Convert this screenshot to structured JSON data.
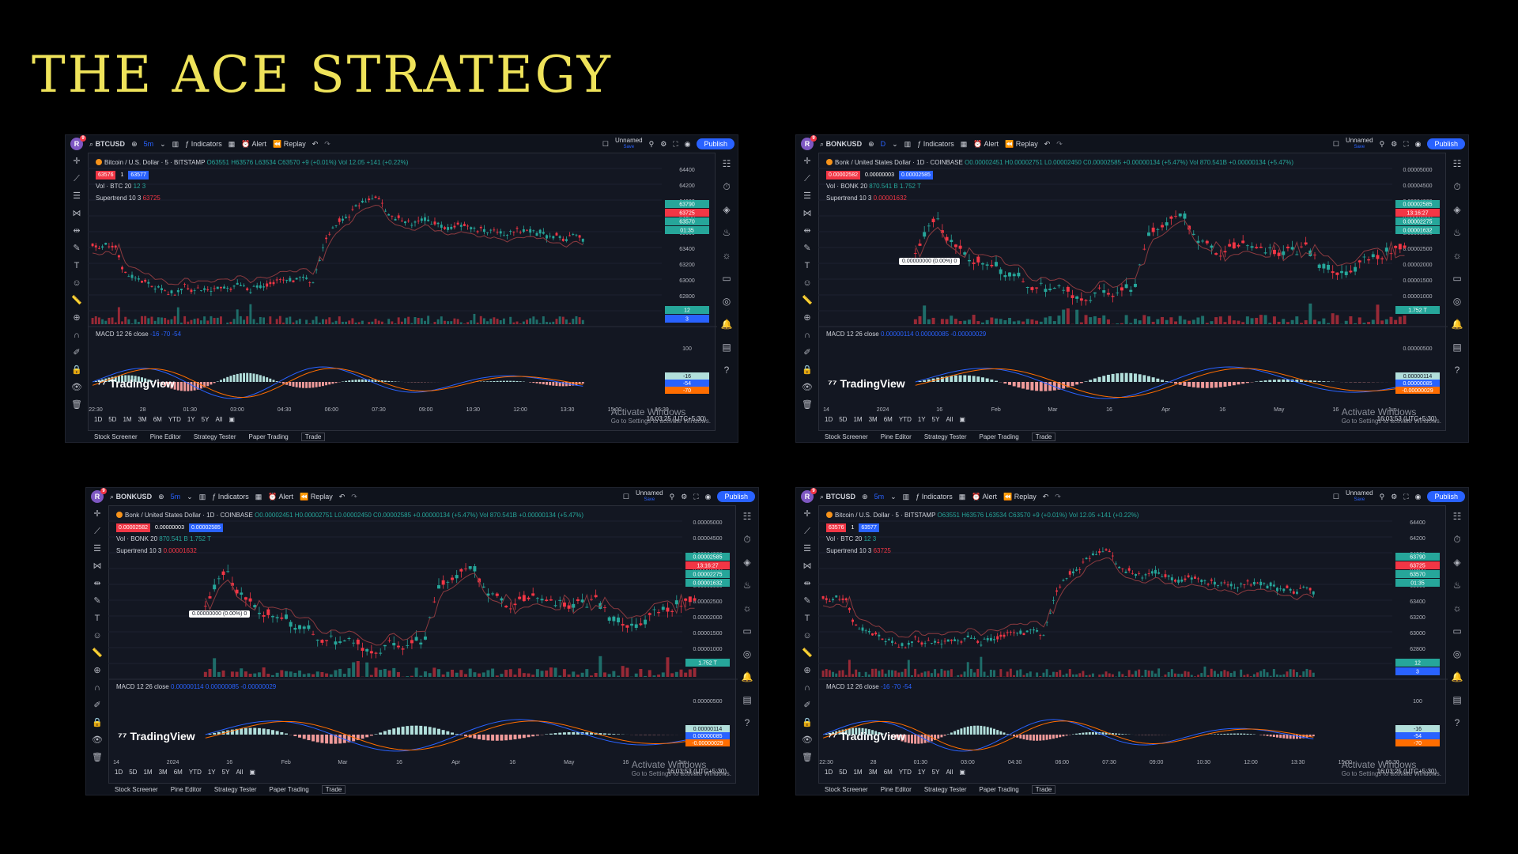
{
  "slide_title": "THE ACE STRATEGY",
  "colors": {
    "accent": "#efe35a",
    "up": "#26a69a",
    "down": "#f23645",
    "blue": "#2962ff",
    "bg": "#131722"
  },
  "panels": [
    {
      "symbol": "BTCUSD",
      "interval": "5m",
      "title": "Bitcoin / U.S. Dollar · 5 · BITSTAMP",
      "ohlc": "O63551 H63576 L63534 C63570 +9 (+0.01%)",
      "vol_reading": "Vol 12.05 +141 (+0.22%)",
      "sell": "63576",
      "qty": "1",
      "buy": "63577",
      "vol_label": "Vol · BTC 20",
      "vol_vals": "12  3",
      "st_label": "Supertrend 10 3",
      "st_val": "63725",
      "macd_label": "MACD 12 26 close",
      "macd_vals": "-16  -70  -54",
      "price_ticks": [
        "64400",
        "64200",
        "64000",
        "63800",
        "63600",
        "63400",
        "63200",
        "63000",
        "62800",
        "62600"
      ],
      "price_tags": [
        "63790",
        "63725",
        "63570",
        "01:35",
        "12",
        "3"
      ],
      "macd_ticks": [
        "100"
      ],
      "macd_tags": [
        "-16",
        "-54",
        "-70"
      ],
      "time_ticks": [
        "22:30",
        "28",
        "01:30",
        "03:00",
        "04:30",
        "06:00",
        "07:30",
        "09:00",
        "10:30",
        "12:00",
        "13:30",
        "15:00",
        "16:30"
      ],
      "tip": "",
      "clock": "16:03:25 (UTC+5:30)",
      "series": {
        "type": "btc",
        "seed": 11
      }
    },
    {
      "symbol": "BONKUSD",
      "interval": "D",
      "title": "Bonk / United States Dollar · 1D · COINBASE",
      "ohlc": "O0.00002451 H0.00002751 L0.00002450 C0.00002585 +0.00000134 (+5.47%)",
      "vol_reading": "Vol 870.541B +0.00000134 (+5.47%)",
      "sell": "0.00002582",
      "qty": "0.00000003",
      "buy": "0.00002585",
      "vol_label": "Vol · BONK 20",
      "vol_vals": "870.541 B  1.752 T",
      "st_label": "Supertrend 10 3",
      "st_val": "0.00001632",
      "macd_label": "MACD 12 26 close",
      "macd_vals": "0.00000114  0.00000085  -0.00000029",
      "price_ticks": [
        "0.00005000",
        "0.00004500",
        "0.00004000",
        "0.00003500",
        "0.00003000",
        "0.00002500",
        "0.00002000",
        "0.00001500",
        "0.00001000",
        "0.00000500"
      ],
      "price_tags": [
        "0.00002585",
        "13:16:27",
        "0.00002275",
        "0.00001632",
        "1.752 T"
      ],
      "macd_ticks": [
        "0.00000500"
      ],
      "macd_tags": [
        "0.00000114",
        "0.00000085",
        "-0.00000029"
      ],
      "time_ticks": [
        "14",
        "2024",
        "16",
        "Feb",
        "Mar",
        "16",
        "Apr",
        "16",
        "May",
        "16",
        "Jun"
      ],
      "tip": "0.00000000 (0.00%) 0",
      "clock": "16:03:53 (UTC+5:30)",
      "series": {
        "type": "bonk",
        "seed": 23
      }
    },
    {
      "symbol": "BONKUSD",
      "interval": "5m",
      "title": "Bonk / United States Dollar · 1D · COINBASE",
      "ohlc": "O0.00002451 H0.00002751 L0.00002450 C0.00002585 +0.00000134 (+5.47%)",
      "vol_reading": "Vol 870.541B +0.00000134 (+5.47%)",
      "sell": "0.00002582",
      "qty": "0.00000003",
      "buy": "0.00002585",
      "vol_label": "Vol · BONK 20",
      "vol_vals": "870.541 B  1.752 T",
      "st_label": "Supertrend 10 3",
      "st_val": "0.00001632",
      "macd_label": "MACD 12 26 close",
      "macd_vals": "0.00000114  0.00000085  -0.00000029",
      "price_ticks": [
        "0.00005000",
        "0.00004500",
        "0.00004000",
        "0.00003500",
        "0.00003000",
        "0.00002500",
        "0.00002000",
        "0.00001500",
        "0.00001000",
        "0.00000500"
      ],
      "price_tags": [
        "0.00002585",
        "13:16:27",
        "0.00002275",
        "0.00001632",
        "1.752 T"
      ],
      "macd_ticks": [
        "0.00000500"
      ],
      "macd_tags": [
        "0.00000114",
        "0.00000085",
        "-0.00000029"
      ],
      "time_ticks": [
        "14",
        "2024",
        "16",
        "Feb",
        "Mar",
        "16",
        "Apr",
        "16",
        "May",
        "16",
        "Jun"
      ],
      "tip": "0.00000000 (0.00%) 0",
      "clock": "16:03:53 (UTC+5:30)",
      "series": {
        "type": "bonk",
        "seed": 23
      }
    },
    {
      "symbol": "BTCUSD",
      "interval": "5m",
      "title": "Bitcoin / U.S. Dollar · 5 · BITSTAMP",
      "ohlc": "O63551 H63576 L63534 C63570 +9 (+0.01%)",
      "vol_reading": "Vol 12.05 +141 (+0.22%)",
      "sell": "63576",
      "qty": "1",
      "buy": "63577",
      "vol_label": "Vol · BTC 20",
      "vol_vals": "12  3",
      "st_label": "Supertrend 10 3",
      "st_val": "63725",
      "macd_label": "MACD 12 26 close",
      "macd_vals": "-16  -70  -54",
      "price_ticks": [
        "64400",
        "64200",
        "64000",
        "63800",
        "63600",
        "63400",
        "63200",
        "63000",
        "62800",
        "62600"
      ],
      "price_tags": [
        "63790",
        "63725",
        "63570",
        "01:35",
        "12",
        "3"
      ],
      "macd_ticks": [
        "100"
      ],
      "macd_tags": [
        "-16",
        "-54",
        "-70"
      ],
      "time_ticks": [
        "22:30",
        "28",
        "01:30",
        "03:00",
        "04:30",
        "06:00",
        "07:30",
        "09:00",
        "10:30",
        "12:00",
        "13:30",
        "15:00",
        "16:30"
      ],
      "tip": "",
      "clock": "16:03:25 (UTC+5:30)",
      "series": {
        "type": "btc",
        "seed": 11
      }
    }
  ],
  "ui": {
    "indicators": "Indicators",
    "alert": "Alert",
    "replay": "Replay",
    "unnamed": "Unnamed",
    "save": "Save",
    "publish": "Publish",
    "ranges": [
      "1D",
      "5D",
      "1M",
      "3M",
      "6M",
      "YTD",
      "1Y",
      "5Y",
      "All"
    ],
    "bottom": [
      "Stock Screener",
      "Pine Editor",
      "Strategy Tester",
      "Paper Trading",
      "Trade"
    ],
    "activate": "Activate Windows",
    "activate_sub": "Go to Settings to activate Windows.",
    "watermark": "TradingView"
  }
}
